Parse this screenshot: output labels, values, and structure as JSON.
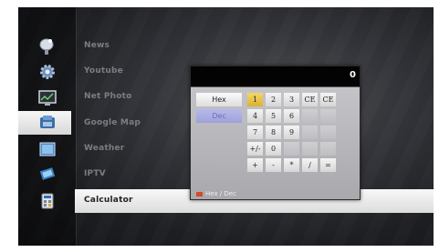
{
  "menu": {
    "items": [
      {
        "label": "News",
        "icon": "satellite-dish-icon"
      },
      {
        "label": "Youtube",
        "icon": "gear-icon"
      },
      {
        "label": "Net Photo",
        "icon": "monitor-chart-icon"
      },
      {
        "label": "Google Map",
        "icon": "phone-icon"
      },
      {
        "label": "Weather",
        "icon": "screen-icon"
      },
      {
        "label": "IPTV",
        "icon": "network-icon"
      },
      {
        "label": "Calculator",
        "icon": "calculator-icon"
      }
    ],
    "selected": "Calculator"
  },
  "calculator": {
    "display": "0",
    "modes": {
      "hex": "Hex",
      "dec": "Dec"
    },
    "keys": {
      "r1": [
        "1",
        "2",
        "3",
        "CE",
        "CE"
      ],
      "r2": [
        "4",
        "5",
        "6",
        "",
        ""
      ],
      "r3": [
        "7",
        "8",
        "9",
        "",
        ""
      ],
      "r4": [
        "+/-",
        "0",
        "",
        "",
        ""
      ],
      "r5": [
        "+",
        "-",
        "*",
        "/",
        "="
      ]
    },
    "hint": "Hex / Dec"
  },
  "colors": {
    "accent_key": "#e7c33f",
    "selection": "#e8e8e8",
    "hint_marker": "#d24b2a",
    "dec_mode": "#a9acdf"
  }
}
